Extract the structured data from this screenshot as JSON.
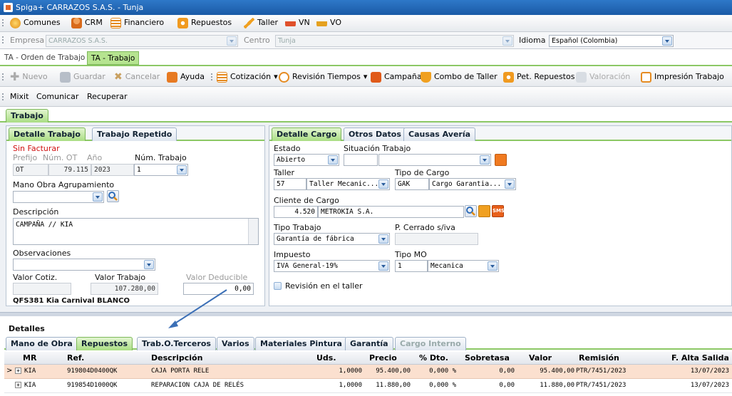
{
  "window": {
    "title": "Spiga+ CARRAZOS S.A.S. - Tunja"
  },
  "menubar": {
    "items": [
      "Comunes",
      "CRM",
      "Financiero",
      "Repuestos",
      "Taller",
      "VN",
      "VO"
    ]
  },
  "context": {
    "empresa_label": "Empresa",
    "empresa_value": "CARRAZOS S.A.S.",
    "centro_label": "Centro",
    "centro_value": "Tunja",
    "idioma_label": "Idioma",
    "idioma_value": "Español (Colombia)"
  },
  "doctabs": [
    "TA - Orden de Trabajo",
    "TA - Trabajo"
  ],
  "toolbar": {
    "nuevo": "Nuevo",
    "guardar": "Guardar",
    "cancelar": "Cancelar",
    "ayuda": "Ayuda",
    "cotizacion": "Cotización",
    "revision_tiempos": "Revisión Tiempos",
    "campana": "Campaña",
    "combo_taller": "Combo de Taller",
    "pet_repuestos": "Pet. Repuestos",
    "valoracion": "Valoración",
    "impresion_trabajo": "Impresión Trabajo"
  },
  "toolbar2": {
    "mixit": "Mixit",
    "comunicar": "Comunicar",
    "recuperar": "Recuperar"
  },
  "main_tab": "Trabajo",
  "left": {
    "tabs": [
      "Detalle Trabajo",
      "Trabajo Repetido"
    ],
    "status": "Sin Facturar",
    "prefijo_label": "Prefijo",
    "num_ot_label": "Núm. OT",
    "ano_label": "Año",
    "num_trabajo_label": "Núm. Trabajo",
    "prefijo": "OT",
    "num_ot": "79.115",
    "ano": "2023",
    "num_trabajo": "1",
    "mano_obra_label": "Mano Obra Agrupamiento",
    "descripcion_label": "Descripción",
    "descripcion": "CAMPAÑA // KIA",
    "observaciones_label": "Observaciones",
    "valor_cotiz_label": "Valor Cotiz.",
    "valor_trabajo_label": "Valor Trabajo",
    "valor_deducible_label": "Valor Deducible",
    "valor_trabajo": "107.280,00",
    "valor_deducible": "0,00",
    "vehiculo": "QFS381 Kia Carnival BLANCO"
  },
  "right": {
    "tabs": [
      "Detalle Cargo",
      "Otros Datos",
      "Causas Avería"
    ],
    "estado_label": "Estado",
    "estado": "Abierto",
    "situacion_label": "Situación Trabajo",
    "taller_label": "Taller",
    "taller_code": "57",
    "taller_name": "Taller Mecanic...",
    "tipo_cargo_label": "Tipo de Cargo",
    "tipo_cargo_code": "GAK",
    "tipo_cargo_name": "Cargo Garantia...",
    "cliente_label": "Cliente de Cargo",
    "cliente_code": "4.520",
    "cliente_name": "METROKIA S.A.",
    "tipo_trabajo_label": "Tipo Trabajo",
    "tipo_trabajo": "Garantía de fábrica",
    "p_cerrado_label": "P. Cerrado s/iva",
    "impuesto_label": "Impuesto",
    "impuesto": "IVA General-19%",
    "tipo_mo_label": "Tipo MO",
    "tipo_mo_code": "1",
    "tipo_mo_name": "Mecanica",
    "revision_label": "Revisión en el taller",
    "sms": "SMS"
  },
  "detalles": {
    "title": "Detalles",
    "tabs": [
      "Mano de Obra",
      "Repuestos",
      "Trab.O.Terceros",
      "Varios",
      "Materiales Pintura",
      "Garantía",
      "Cargo Interno"
    ],
    "columns": [
      "MR",
      "Ref.",
      "Descripción",
      "Uds.",
      "Precio",
      "% Dto.",
      "Sobretasa",
      "Valor",
      "Remisión",
      "F. Alta Salida"
    ],
    "rows": [
      [
        "KIA",
        "919804D0400QK",
        "CAJA PORTA RELE",
        "1,0000",
        "95.400,00",
        "0,000 %",
        "0,00",
        "95.400,00",
        "PTR/7451/2023",
        "13/07/2023"
      ],
      [
        "KIA",
        "919854D1000QK",
        "REPARACION CAJA DE RELÉS",
        "1,0000",
        "11.880,00",
        "0,000 %",
        "0,00",
        "11.880,00",
        "PTR/7451/2023",
        "13/07/2023"
      ]
    ]
  },
  "colors": {
    "accent_green": "#a9dd83",
    "title_blue": "#1a5aa6",
    "status_red": "#d01010",
    "row_selected": "#fbe0cf"
  }
}
